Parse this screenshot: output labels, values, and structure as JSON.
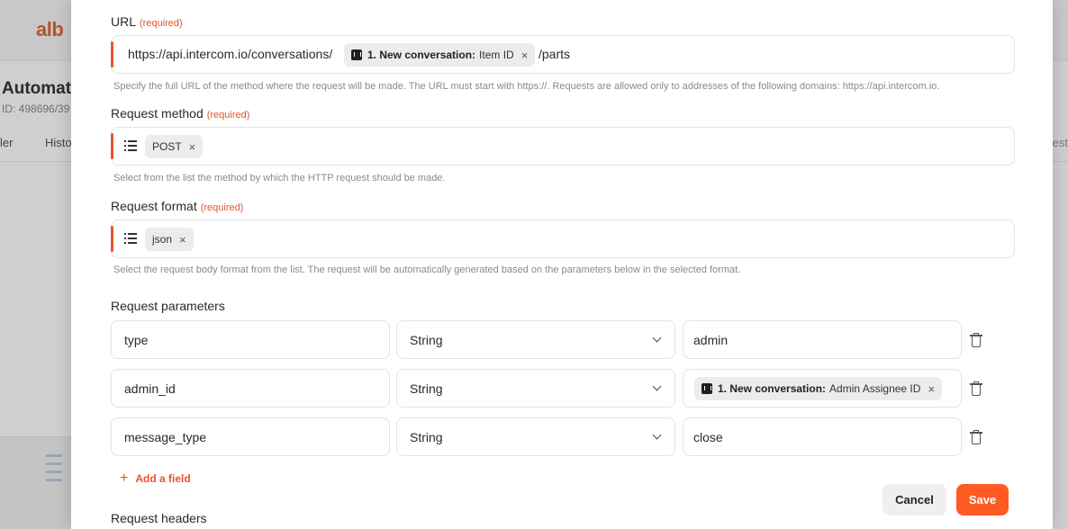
{
  "background": {
    "logo": "alb",
    "title": "Automati",
    "id_text": "ID: 498696/39",
    "tabs": [
      "ler",
      "Histo"
    ],
    "tab_right": "est"
  },
  "url_section": {
    "label": "URL",
    "required": "(required)",
    "prefix": "https://api.intercom.io/conversations/",
    "chip_source": "1. New conversation:",
    "chip_value": "Item ID",
    "suffix": "/parts",
    "hint": "Specify the full URL of the method where the request will be made. The URL must start with https://. Requests are allowed only to addresses of the following domains: https://api.intercom.io."
  },
  "method_section": {
    "label": "Request method",
    "required": "(required)",
    "value": "POST",
    "hint": "Select from the list the method by which the HTTP request should be made."
  },
  "format_section": {
    "label": "Request format",
    "required": "(required)",
    "value": "json",
    "hint": "Select the request body format from the list. The request will be automatically generated based on the parameters below in the selected format."
  },
  "params": {
    "label": "Request parameters",
    "rows": [
      {
        "name": "type",
        "kind": "String",
        "value": "admin"
      },
      {
        "name": "admin_id",
        "kind": "String",
        "chip_source": "1. New conversation:",
        "chip_value": "Admin Assignee ID"
      },
      {
        "name": "message_type",
        "kind": "String",
        "value": "close"
      }
    ],
    "add_label": "Add a field"
  },
  "headers_label": "Request headers",
  "buttons": {
    "cancel": "Cancel",
    "save": "Save"
  },
  "colors": {
    "accent": "#ff5a22",
    "required": "#e8542b"
  }
}
